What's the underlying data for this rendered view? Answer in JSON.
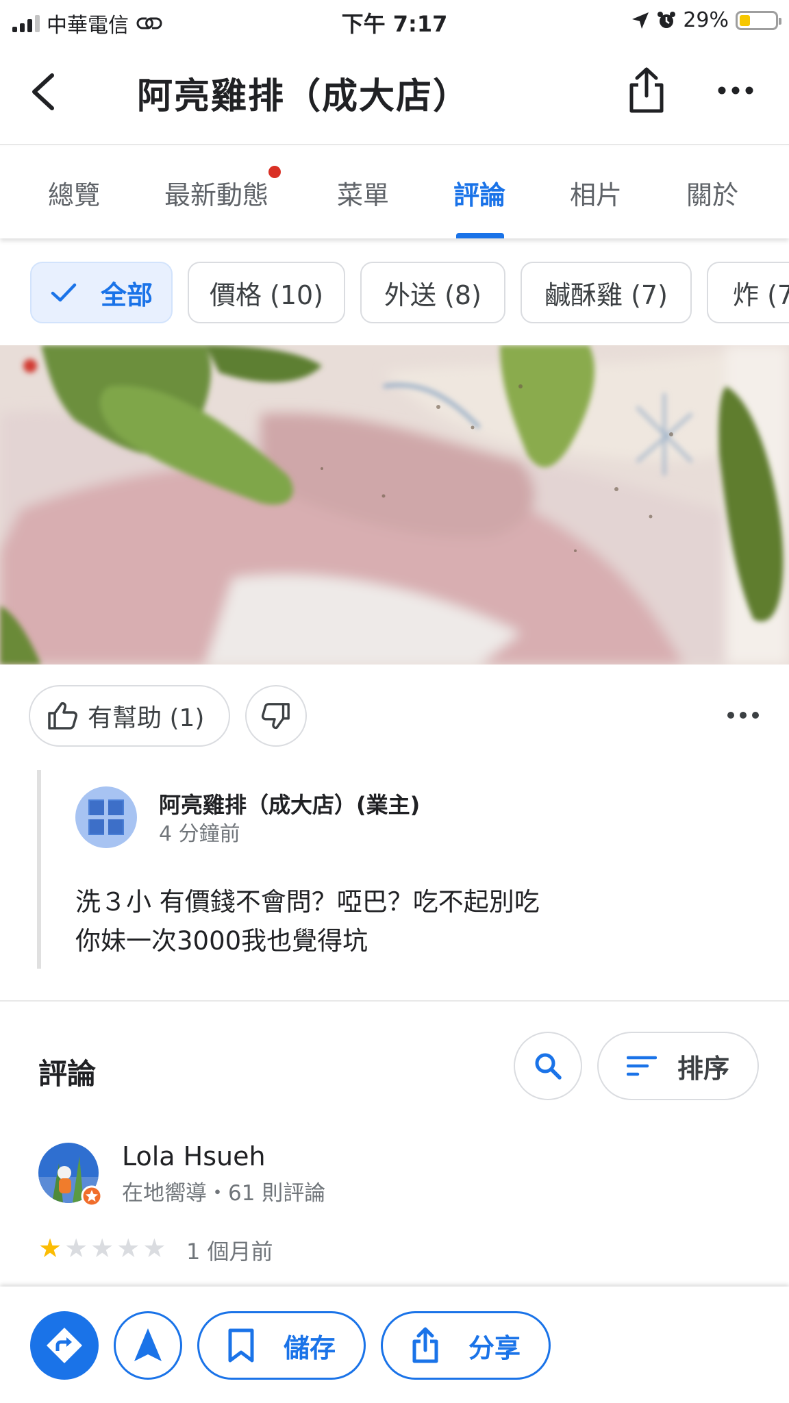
{
  "status_bar": {
    "carrier": "中華電信",
    "time": "下午 7:17",
    "battery": "29%",
    "battery_level": 0.29
  },
  "header": {
    "title": "阿亮雞排（成大店）"
  },
  "tabs": [
    {
      "label": "總覽"
    },
    {
      "label": "最新動態"
    },
    {
      "label": "菜單"
    },
    {
      "label": "評論"
    },
    {
      "label": "相片"
    },
    {
      "label": "關於"
    }
  ],
  "active_tab": "評論",
  "chips": [
    {
      "label": "全部"
    },
    {
      "label": "價格 (10)"
    },
    {
      "label": "外送 (8)"
    },
    {
      "label": "鹹酥雞 (7)"
    },
    {
      "label": "炸 (7"
    }
  ],
  "review_actions": {
    "helpful_label": "有幫助 (1)"
  },
  "owner_reply": {
    "name": "阿亮雞排（成大店）(業主)",
    "time": "4 分鐘前",
    "text_line1": "洗３小 有價錢不會問？啞巴？吃不起別吃",
    "text_line2": "你妹一次3000我也覺得坑"
  },
  "reviews_section": {
    "title": "評論",
    "sort_label": "排序"
  },
  "reviewer": {
    "name": "Lola Hsueh",
    "meta": "在地嚮導・61 則評論",
    "rating": 1,
    "max_rating": 5,
    "time": "1 個月前"
  },
  "bottom_bar": {
    "save_label": "儲存",
    "share_label": "分享"
  },
  "colors": {
    "accent": "#1a73e8",
    "star": "#fbbc04",
    "badge": "#d93025"
  },
  "icons": [
    "signal-icon",
    "link-icon",
    "location-arrow-icon",
    "alarm-icon",
    "battery-icon",
    "back-arrow-icon",
    "share-icon",
    "more-icon",
    "checkmark-icon",
    "thumbs-up-icon",
    "thumbs-down-icon",
    "search-icon",
    "sort-icon",
    "directions-icon",
    "navigation-icon",
    "bookmark-icon"
  ]
}
